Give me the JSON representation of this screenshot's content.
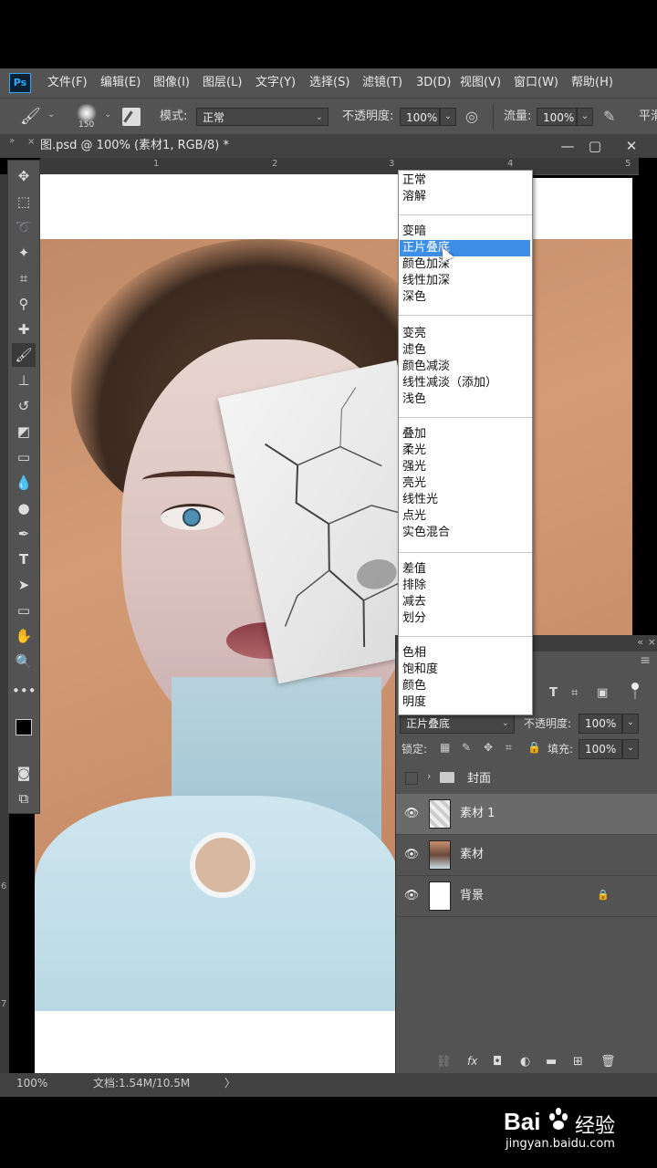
{
  "app": {
    "logo": "Ps",
    "menu": [
      "文件(F)",
      "编辑(E)",
      "图像(I)",
      "图层(L)",
      "文字(Y)",
      "选择(S)",
      "滤镜(T)",
      "3D(D)",
      "视图(V)",
      "窗口(W)",
      "帮助(H)"
    ]
  },
  "options": {
    "brush_size": "150",
    "mode_label": "模式:",
    "mode_value": "正常",
    "opacity_label": "不透明度:",
    "opacity_value": "100%",
    "flow_label": "流量:",
    "flow_value": "100%",
    "smooth_label": "平滑"
  },
  "document": {
    "tab_title": "图.psd @ 100% (素材1, RGB/8) *",
    "ruler_marks": [
      "1",
      "2",
      "3",
      "4",
      "5"
    ],
    "vruler_marks": [
      "6",
      "7"
    ]
  },
  "blend_menu": {
    "groups": [
      [
        "正常",
        "溶解"
      ],
      [
        "变暗",
        "正片叠底",
        "颜色加深",
        "线性加深",
        "深色"
      ],
      [
        "变亮",
        "滤色",
        "颜色减淡",
        "线性减淡（添加）",
        "浅色"
      ],
      [
        "叠加",
        "柔光",
        "强光",
        "亮光",
        "线性光",
        "点光",
        "实色混合"
      ],
      [
        "差值",
        "排除",
        "减去",
        "划分"
      ],
      [
        "色相",
        "饱和度",
        "颜色",
        "明度"
      ]
    ],
    "highlighted": "正片叠底"
  },
  "layers": {
    "blend_value": "正片叠底",
    "opacity_label": "不透明度:",
    "opacity_value": "100%",
    "lock_label": "锁定:",
    "fill_label": "填充:",
    "fill_value": "100%",
    "items": [
      {
        "name": "封面",
        "type": "group"
      },
      {
        "name": "素材 1",
        "type": "layer"
      },
      {
        "name": "素材",
        "type": "layer"
      },
      {
        "name": "背景",
        "type": "background"
      }
    ]
  },
  "status": {
    "zoom": "100%",
    "doc_info": "文档:1.54M/10.5M",
    "arrow": "〉"
  },
  "watermark": {
    "brand": "Bai",
    "brand2": "经验",
    "url": "jingyan.baidu.com"
  },
  "colors": {
    "panel": "#535353",
    "highlight": "#3d8ee6"
  }
}
